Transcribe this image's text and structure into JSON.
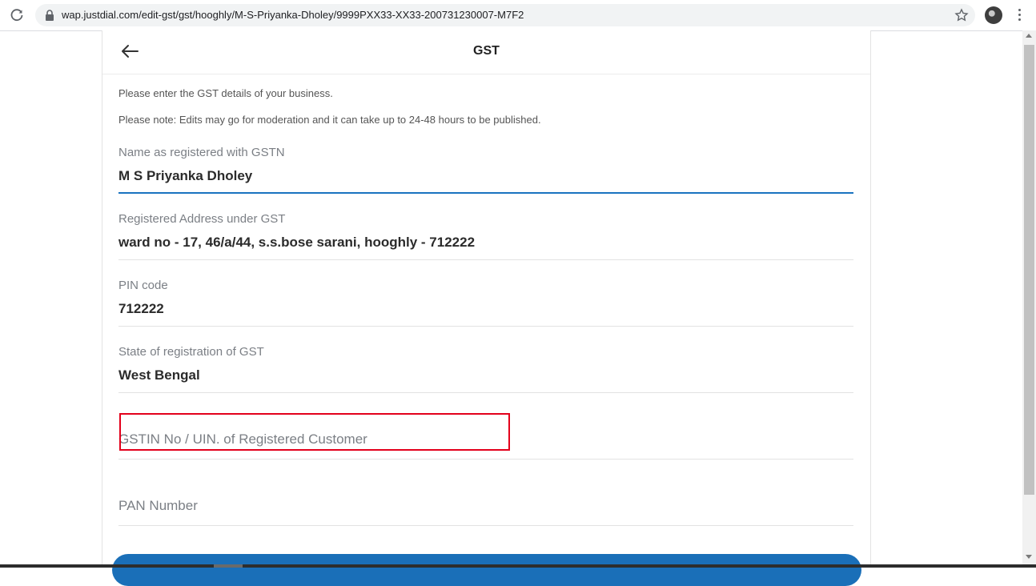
{
  "browser": {
    "url": "wap.justdial.com/edit-gst/gst/hooghly/M-S-Priyanka-Dholey/9999PXX33-XX33-200731230007-M7F2"
  },
  "header": {
    "title": "GST"
  },
  "notes": {
    "intro": "Please enter the GST details of your business.",
    "moderation": "Please note: Edits may go for moderation and it can take up to 24-48 hours to be published."
  },
  "fields": {
    "name": {
      "label": "Name as registered with GSTN",
      "value": "M S Priyanka Dholey"
    },
    "address": {
      "label": "Registered Address under GST",
      "value": "ward no - 17, 46/a/44, s.s.bose sarani, hooghly - 712222"
    },
    "pin": {
      "label": "PIN code",
      "value": "712222"
    },
    "state": {
      "label": "State of registration of GST",
      "value": "West Bengal"
    },
    "gstin": {
      "placeholder": "GSTIN No / UIN. of Registered Customer"
    },
    "pan": {
      "placeholder": "PAN Number"
    }
  },
  "colors": {
    "accent": "#1a73c0",
    "highlight": "#e3001b",
    "button": "#1a6fb8"
  }
}
